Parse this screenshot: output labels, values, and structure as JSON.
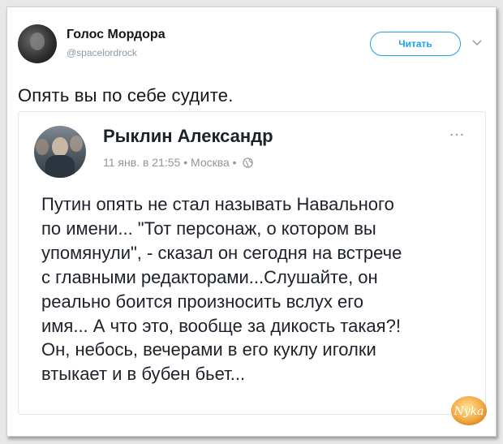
{
  "tweet": {
    "author_name": "Голос Мордора",
    "author_handle": "@spacelordrock",
    "follow_label": "Читать",
    "text": "Опять вы по себе судите."
  },
  "embedded_post": {
    "author_name": "Рыклин Александр",
    "meta": "11 янв. в 21:55 • Москва •",
    "text_lines": [
      "Путин опять не стал называть Навального",
      "по имени... \"Тот персонаж, о котором вы",
      "упомянули\", - сказал он сегодня на встрече",
      "с главными редакторами...Слушайте, он",
      "реально боится произносить вслух его",
      "имя... А что это, вообще за дикость такая?!",
      "Он, небось, вечерами в его куклу иголки",
      "втыкает и в бубен бьет..."
    ]
  },
  "watermark": {
    "text": "Nyka"
  },
  "icons": [
    "chevron-down-icon",
    "globe-icon",
    "more-options-icon"
  ],
  "colors": {
    "accent": "#1da1f2",
    "handle": "#8899a6",
    "meta": "#90949c",
    "watermark": "#f3a230"
  }
}
